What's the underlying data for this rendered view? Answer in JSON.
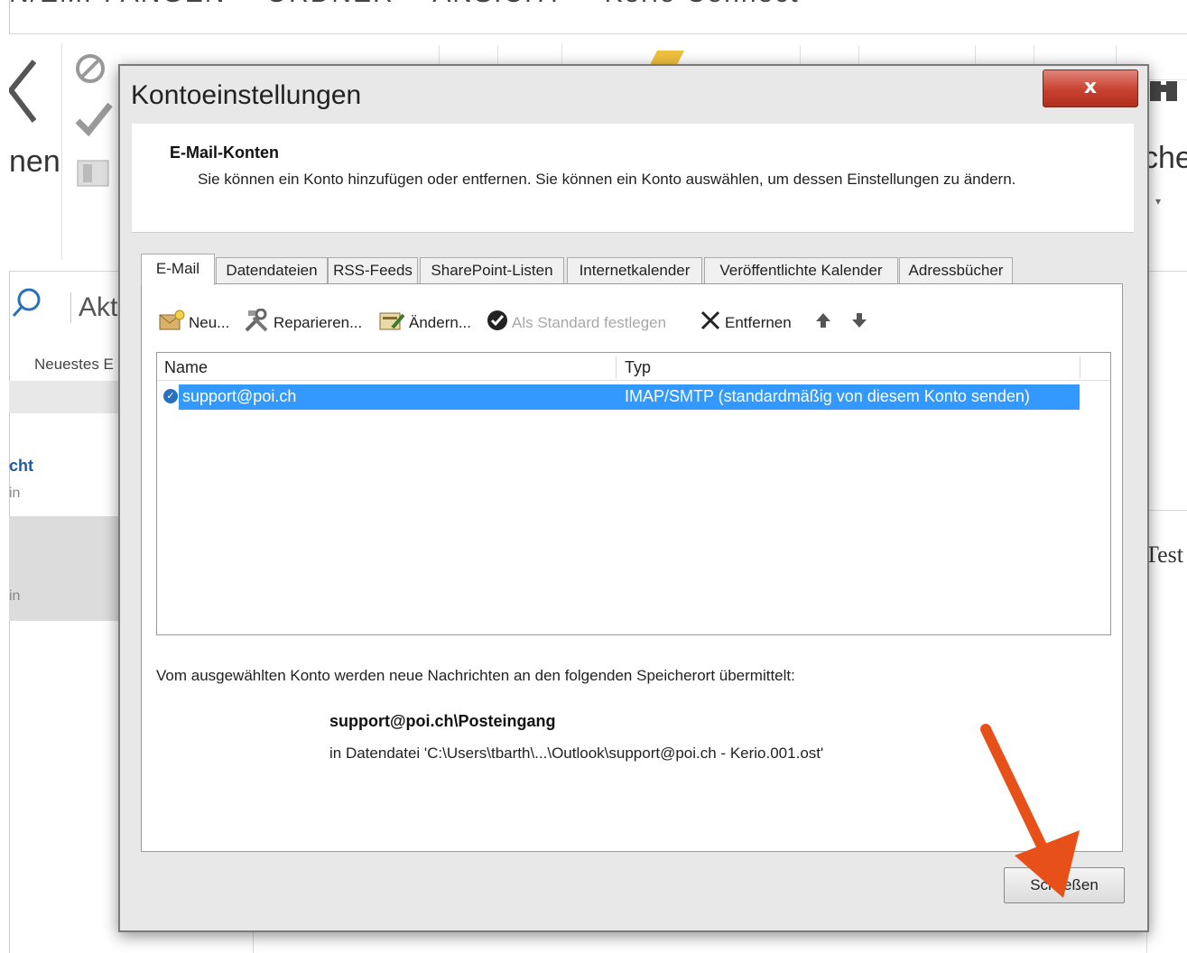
{
  "background": {
    "menubar": [
      "N/EMPFANGEN",
      "ORDNER",
      "ANSICHT",
      "Kerio Connect"
    ],
    "ribbon_left_label": "nen",
    "ribbon_right_label": "che",
    "search_placeholder": "Akt",
    "sort_label": "Neuestes E",
    "folder_label_a": "cht",
    "folder_sub_a": "in",
    "folder_sub_b": "in",
    "right_text": "Test"
  },
  "dialog": {
    "title": "Kontoeinstellungen",
    "close_glyph": "x",
    "header": {
      "title": "E-Mail-Konten",
      "description": "Sie können ein Konto hinzufügen oder entfernen. Sie können ein Konto auswählen, um dessen Einstellungen zu ändern."
    },
    "tabs": [
      {
        "label": "E-Mail",
        "active": true
      },
      {
        "label": "Datendateien"
      },
      {
        "label": "RSS-Feeds"
      },
      {
        "label": "SharePoint-Listen"
      },
      {
        "label": "Internetkalender"
      },
      {
        "label": "Veröffentlichte Kalender"
      },
      {
        "label": "Adressbücher"
      }
    ],
    "toolbar": {
      "new": "Neu...",
      "repair": "Reparieren...",
      "change": "Ändern...",
      "set_default": "Als Standard festlegen",
      "remove": "Entfernen"
    },
    "table": {
      "columns": [
        "Name",
        "Typ"
      ],
      "rows": [
        {
          "name": "support@poi.ch",
          "type": "IMAP/SMTP (standardmäßig von diesem Konto senden)",
          "selected": true,
          "default": true
        }
      ]
    },
    "delivery": {
      "label": "Vom ausgewählten Konto werden neue Nachrichten an den folgenden Speicherort übermittelt:",
      "folder": "support@poi.ch\\Posteingang",
      "file": "in Datendatei 'C:\\Users\\tbarth\\...\\Outlook\\support@poi.ch - Kerio.001.ost'"
    },
    "close_button": "Schließen"
  },
  "colors": {
    "selection": "#3399ff",
    "close_red": "#c7412f",
    "annotation_arrow": "#e8501a"
  }
}
